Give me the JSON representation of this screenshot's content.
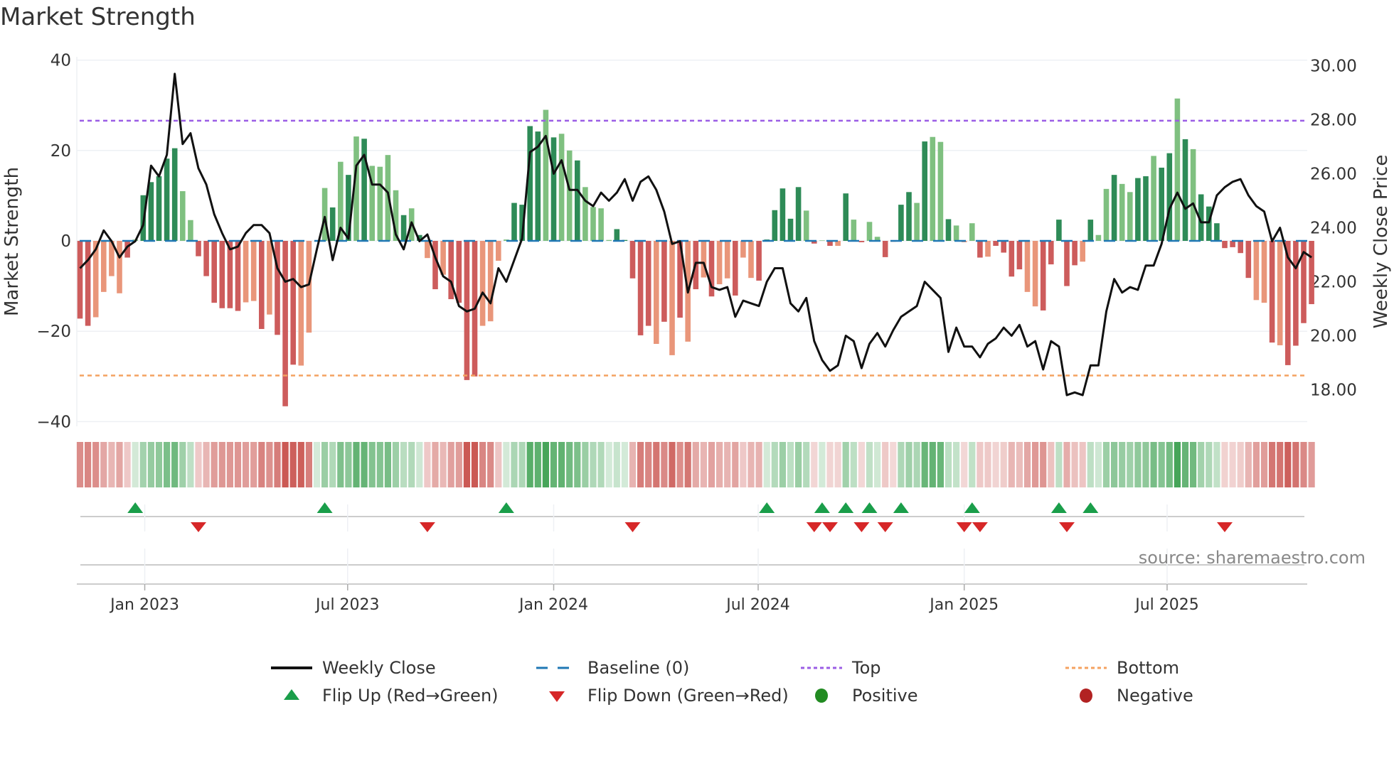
{
  "chart_data": {
    "type": "bar",
    "title": "Market Strength",
    "ylabel": "Market Strength",
    "y2label": "Weekly Close Price",
    "ylim": [
      -40,
      40
    ],
    "y2lim": [
      16.6,
      30.4
    ],
    "yticks": [
      "40",
      "20",
      "0",
      "−20",
      "−40"
    ],
    "ytick_values": [
      40,
      20,
      0,
      -20,
      -40
    ],
    "y2ticks": [
      "30.00",
      "28.00",
      "26.00",
      "24.00",
      "22.00",
      "20.00",
      "18.00"
    ],
    "y2tick_values": [
      30,
      28,
      26,
      24,
      22,
      20,
      18
    ],
    "xticks": [
      {
        "label": "Jan 2023",
        "week": 8.2
      },
      {
        "label": "Jul 2023",
        "week": 33.9
      },
      {
        "label": "Jan 2024",
        "week": 60.0
      },
      {
        "label": "Jul 2024",
        "week": 85.9
      },
      {
        "label": "Jan 2025",
        "week": 112.0
      },
      {
        "label": "Jul 2025",
        "week": 137.7
      }
    ],
    "top_level": 26.6,
    "bottom_level": -29.8,
    "baseline": 0,
    "strength": [
      -17.2,
      -18.8,
      -16.9,
      -11.3,
      -7.8,
      -11.6,
      -3.7,
      0.3,
      10.1,
      13,
      14.3,
      18.2,
      20.5,
      11,
      4.6,
      -3.4,
      -7.8,
      -13.7,
      -14.9,
      -14.9,
      -15.5,
      -13.6,
      -13.3,
      -19.5,
      -16.3,
      -20.8,
      -36.6,
      -27.4,
      -27.6,
      -20.3,
      0,
      11.7,
      7.4,
      17.5,
      14.6,
      23.1,
      22.6,
      16.6,
      16.4,
      19,
      11.2,
      5.7,
      7.2,
      1.3,
      -3.8,
      -10.7,
      -7.5,
      -12.9,
      -13.7,
      -30.8,
      -30,
      -18.8,
      -17.8,
      -4.4,
      0.3,
      8.4,
      8,
      25.4,
      24.2,
      29,
      22.9,
      23.7,
      20,
      17.8,
      11.9,
      7.5,
      7.2,
      0.2,
      2.6,
      0.2,
      -8.3,
      -20.9,
      -18.8,
      -22.8,
      -17.9,
      -25.3,
      -17,
      -22.3,
      -10.7,
      -8.1,
      -12.3,
      -9.6,
      -8.3,
      -12.1,
      -3.7,
      -8.2,
      -8.8,
      0.3,
      6.8,
      11.6,
      4.9,
      11.9,
      6.7,
      -0.6,
      0.1,
      -1.1,
      -1.1,
      10.5,
      4.7,
      -0.3,
      4.2,
      0.9,
      -3.6,
      -0.2,
      8,
      10.8,
      8.4,
      22,
      23,
      21.9,
      4.8,
      3.4,
      -0.3,
      3.9,
      -3.7,
      -3.5,
      -1.1,
      -2.6,
      -7.9,
      -6.3,
      -11.3,
      -14.5,
      -15.4,
      -5.2,
      4.7,
      -10,
      -5.4,
      -4.6,
      4.7,
      1.3,
      11.5,
      14.6,
      12.6,
      10.8,
      13.9,
      14.3,
      18.8,
      16.2,
      19.4,
      31.5,
      22.5,
      20.3,
      10.3,
      7.6,
      3.9,
      -1.6,
      -1.4,
      -2.7,
      -8.2,
      -13.1,
      -13.7,
      -22.5,
      -23.1,
      -27.5,
      -23.2,
      -18.2,
      -14
    ],
    "shade": "ddlllldldddddllddddddlldldddlldldldldlllldldldlddddllllddddldlldlllldddddldldldldlldllddddddldldldldlldlddldlldllldlddddlldddddldlldllddlddldldddddddlldlddddlddddddddlll",
    "weekly_close": [
      22.5,
      22.8,
      23.2,
      23.9,
      23.5,
      22.9,
      23.3,
      23.5,
      24.1,
      26.3,
      25.9,
      26.7,
      29.7,
      27.1,
      27.5,
      26.2,
      25.6,
      24.5,
      23.8,
      23.2,
      23.3,
      23.8,
      24.1,
      24.1,
      23.8,
      22.5,
      22.0,
      22.1,
      21.8,
      21.9,
      23.2,
      24.4,
      22.8,
      24.0,
      23.6,
      26.3,
      26.7,
      25.6,
      25.6,
      25.3,
      23.75,
      23.2,
      24.2,
      23.5,
      23.75,
      22.9,
      22.2,
      22.0,
      21.1,
      20.9,
      21.0,
      21.6,
      21.2,
      22.5,
      22.0,
      22.8,
      23.6,
      26.8,
      27.0,
      27.4,
      26.0,
      26.5,
      25.4,
      25.4,
      25.0,
      24.8,
      25.3,
      25.0,
      25.3,
      25.8,
      25.0,
      25.7,
      25.9,
      25.4,
      24.6,
      23.4,
      23.5,
      21.6,
      22.7,
      22.7,
      21.8,
      21.7,
      21.8,
      20.7,
      21.3,
      21.2,
      21.1,
      22.0,
      22.5,
      22.5,
      21.2,
      20.9,
      21.4,
      19.8,
      19.1,
      18.7,
      18.9,
      20.0,
      19.8,
      18.8,
      19.7,
      20.1,
      19.6,
      20.2,
      20.7,
      20.9,
      21.1,
      22.0,
      21.7,
      21.4,
      19.4,
      20.3,
      19.6,
      19.6,
      19.2,
      19.7,
      19.9,
      20.3,
      20.0,
      20.4,
      19.6,
      19.8,
      18.75,
      19.8,
      19.6,
      17.8,
      17.9,
      17.8,
      18.9,
      18.9,
      20.9,
      22.1,
      21.6,
      21.8,
      21.7,
      22.6,
      22.6,
      23.4,
      24.7,
      25.3,
      24.7,
      24.9,
      24.2,
      24.2,
      25.2,
      25.5,
      25.7,
      25.8,
      25.2,
      24.8,
      24.6,
      23.5,
      24.0,
      22.9,
      22.5,
      23.1,
      22.9
    ],
    "flip_up_weeks": [
      7,
      31,
      54,
      87,
      94,
      97,
      100,
      104,
      113,
      124,
      128
    ],
    "flip_down_weeks": [
      15,
      44,
      70,
      93,
      95,
      99,
      102,
      112,
      114,
      125,
      145
    ],
    "legend": [
      "Weekly Close",
      "Baseline (0)",
      "Top",
      "Bottom",
      "Flip Up (Red→Green)",
      "Flip Down (Green→Red)",
      "Positive",
      "Negative"
    ],
    "legend_placement": "bottom",
    "source": "source: sharemaestro.com"
  },
  "colors": {
    "dark_green": "#2e8b57",
    "light_green": "#7fc080",
    "dark_red": "#cd5c5c",
    "light_red": "#e9967a",
    "close": "#111111",
    "baseline": "#1f77b4",
    "top": "#9b5de5",
    "bottom": "#f4a261",
    "flip_up": "#1a9e4a",
    "flip_down": "#d62728",
    "positive": "#228b22",
    "negative": "#b22222"
  }
}
